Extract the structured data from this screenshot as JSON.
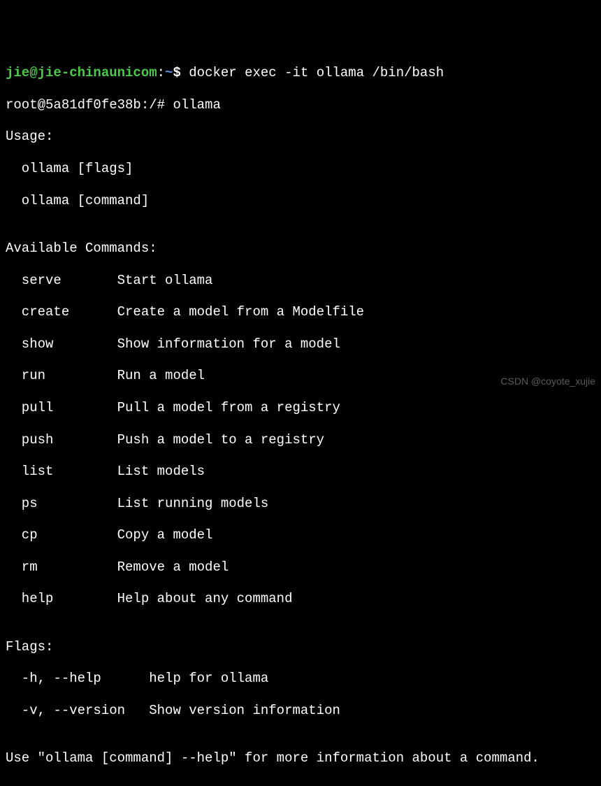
{
  "prompt1": {
    "user_host": "jie@jie-chinaunicom",
    "colon": ":",
    "path": "~",
    "dollar": "$",
    "command": " docker exec -it ollama /bin/bash"
  },
  "prompt2": {
    "prefix": "root@5a81df0fe38b:/#",
    "command": " ollama"
  },
  "usage_header": "Usage:",
  "usage_lines": [
    "  ollama [flags]",
    "  ollama [command]"
  ],
  "blank": "",
  "commands_header": "Available Commands:",
  "commands": [
    "  serve       Start ollama",
    "  create      Create a model from a Modelfile",
    "  show        Show information for a model",
    "  run         Run a model",
    "  pull        Pull a model from a registry",
    "  push        Push a model to a registry",
    "  list        List models",
    "  ps          List running models",
    "  cp          Copy a model",
    "  rm          Remove a model",
    "  help        Help about any command"
  ],
  "flags_header": "Flags:",
  "flags": [
    "  -h, --help      help for ollama",
    "  -v, --version   Show version information"
  ],
  "footer": "Use \"ollama [command] --help\" for more information about a command.",
  "watermark": "CSDN @coyote_xujie"
}
